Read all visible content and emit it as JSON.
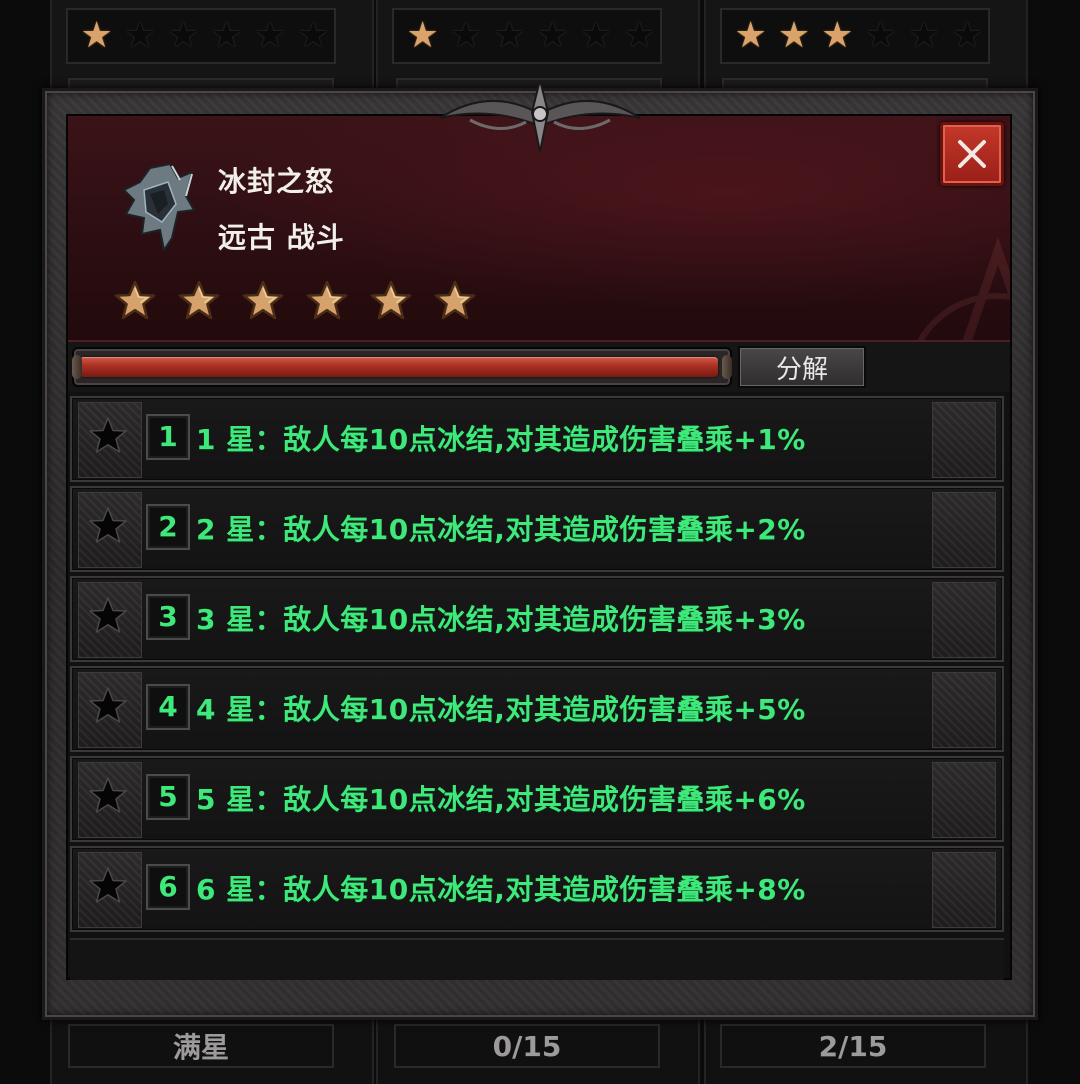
{
  "background": {
    "top_star_groups": [
      {
        "filled": 1,
        "total": 6
      },
      {
        "filled": 1,
        "total": 6
      },
      {
        "filled": 3,
        "total": 6
      }
    ],
    "bottom_labels": [
      "满星",
      "0/15",
      "2/15"
    ]
  },
  "modal": {
    "item_name": "冰封之怒",
    "item_type": "远古 战斗",
    "item_icon": "axe-icon",
    "stars_filled": 6,
    "progress_fraction": 0.99,
    "decompose_label": "分解",
    "close_icon": "close-icon",
    "star_effects": [
      {
        "number": "1",
        "text": "1 星：敌人每10点冰结,对其造成伤害叠乘+1%"
      },
      {
        "number": "2",
        "text": "2 星：敌人每10点冰结,对其造成伤害叠乘+2%"
      },
      {
        "number": "3",
        "text": "3 星：敌人每10点冰结,对其造成伤害叠乘+3%"
      },
      {
        "number": "4",
        "text": "4 星：敌人每10点冰结,对其造成伤害叠乘+5%"
      },
      {
        "number": "5",
        "text": "5 星：敌人每10点冰结,对其造成伤害叠乘+6%"
      },
      {
        "number": "6",
        "text": "6 星：敌人每10点冰结,对其造成伤害叠乘+8%"
      }
    ]
  },
  "colors": {
    "effect_text": "#3ee87a",
    "header_red": "#3b1318",
    "star_gold": "#d9a36a",
    "close_red": "#c4382a"
  }
}
